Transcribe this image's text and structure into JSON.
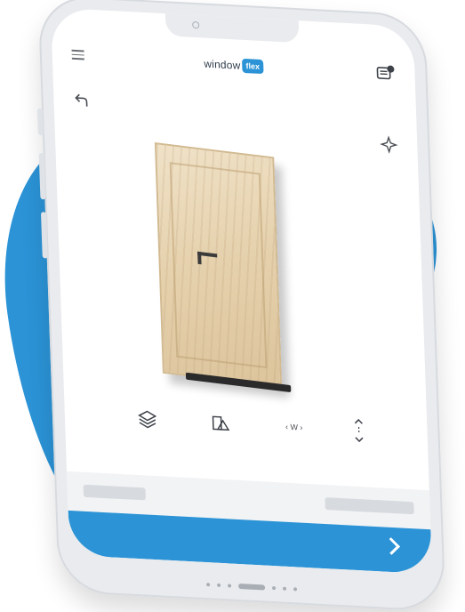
{
  "header": {
    "logo_word": "window",
    "logo_badge": "flex"
  },
  "toolbar": {
    "size_label": "‹ W ›",
    "tools": [
      "layers",
      "shapes",
      "width",
      "height"
    ]
  },
  "colors": {
    "accent": "#2b93d6",
    "door_wood": "#e6d2ae",
    "frame": "#e9ebee"
  },
  "icons": [
    "menu-icon",
    "cart-icon",
    "back-icon",
    "sparkle-icon",
    "layers-icon",
    "shapes-icon",
    "width-icon",
    "height-icon",
    "next-arrow-icon"
  ]
}
